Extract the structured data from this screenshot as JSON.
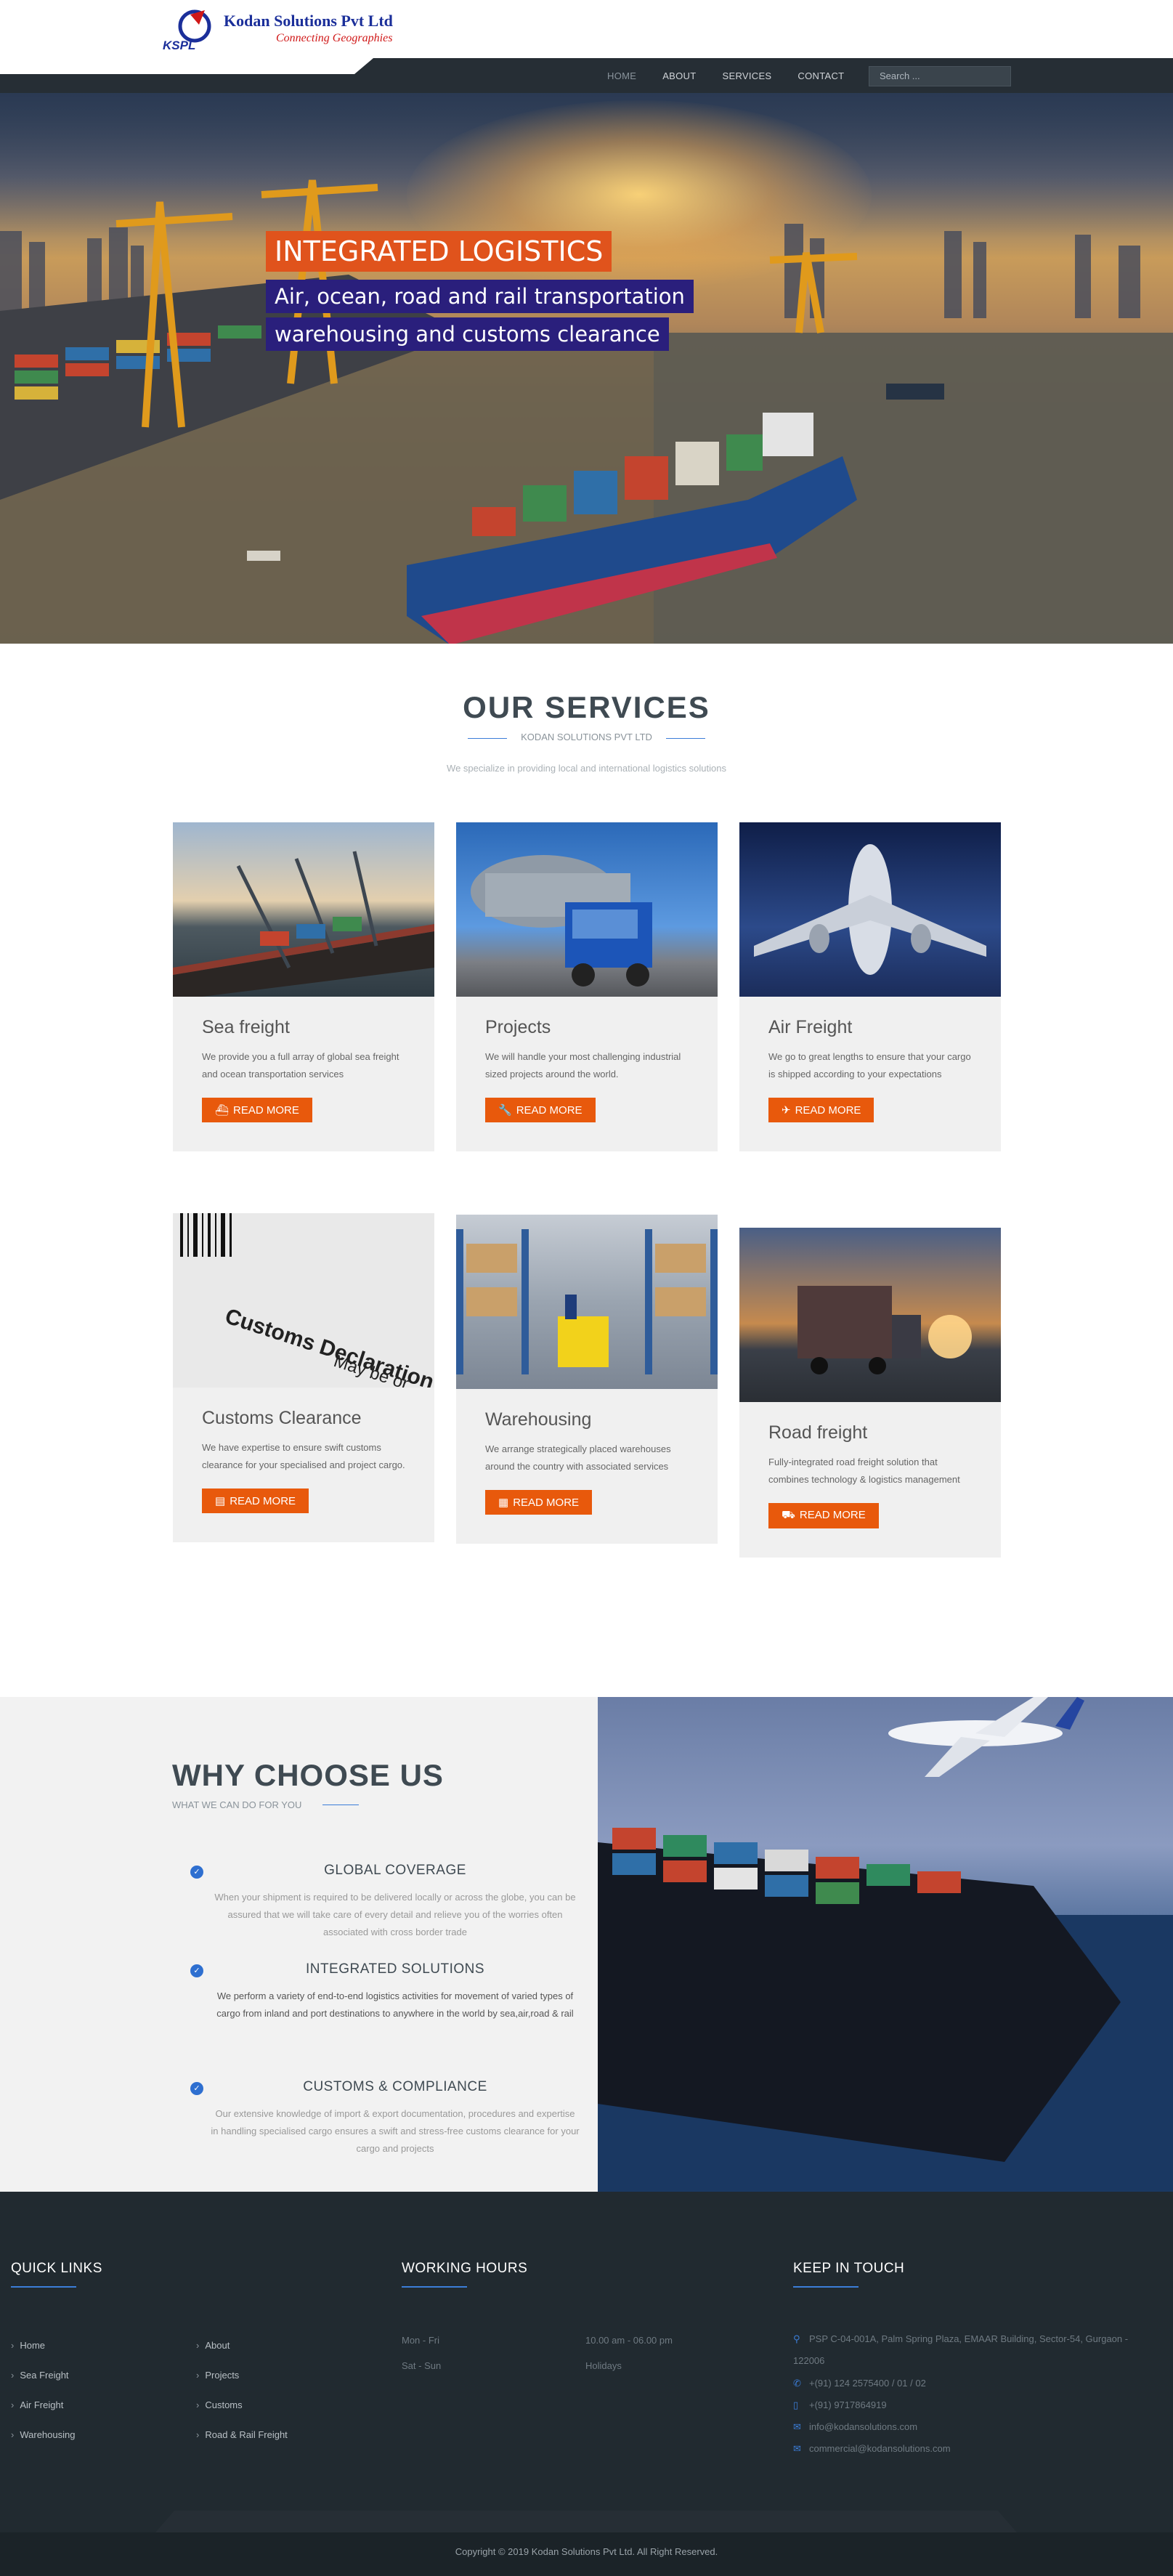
{
  "header": {
    "company_name": "Kodan Solutions Pvt Ltd",
    "tagline": "Connecting Geographies",
    "logo_abbr": "KSPL",
    "nav": [
      {
        "label": "HOME"
      },
      {
        "label": "ABOUT"
      },
      {
        "label": "SERVICES"
      },
      {
        "label": "CONTACT"
      }
    ],
    "search_placeholder": "Search ..."
  },
  "hero": {
    "title": "INTEGRATED LOGISTICS",
    "line1": "Air, ocean, road and rail transportation",
    "line2": "warehousing and customs clearance"
  },
  "services": {
    "title": "OUR SERVICES",
    "subtitle": "KODAN SOLUTIONS PVT LTD",
    "description": "We specialize in providing local and international logistics solutions",
    "cards": [
      {
        "title": "Sea freight",
        "text": "We provide you a full array of global sea freight and ocean transportation services",
        "button": "READ MORE",
        "icon": "ship-icon"
      },
      {
        "title": "Projects",
        "text": "We will handle your most challenging industrial sized projects around the world.",
        "button": "READ MORE",
        "icon": "wrench-icon"
      },
      {
        "title": "Air Freight",
        "text": "We go to great lengths to ensure that your cargo is shipped according to your expectations",
        "button": "READ MORE",
        "icon": "plane-icon"
      },
      {
        "title": "Customs Clearance",
        "text": "We have expertise to ensure swift customs clearance for your specialised and project cargo.",
        "button": "READ MORE",
        "icon": "document-icon"
      },
      {
        "title": "Warehousing",
        "text": "We arrange strategically placed warehouses around the country with associated services",
        "button": "READ MORE",
        "icon": "boxes-icon"
      },
      {
        "title": "Road freight",
        "text": "Fully-integrated road freight solution that combines technology & logistics management",
        "button": "READ MORE",
        "icon": "truck-icon"
      }
    ]
  },
  "why": {
    "title": "WHY CHOOSE US",
    "subtitle": "WHAT WE CAN DO FOR YOU",
    "items": [
      {
        "title": "GLOBAL COVERAGE",
        "text": "When your shipment is required to be delivered locally or across the globe, you can be assured that we will take care of every detail and relieve you of the worries often associated with cross border trade"
      },
      {
        "title": "INTEGRATED SOLUTIONS",
        "text": "We perform a variety of end-to-end logistics activities for movement of varied types of cargo from inland and port destinations to anywhere in the world by sea,air,road & rail"
      },
      {
        "title": "CUSTOMS & COMPLIANCE",
        "text": "Our extensive knowledge of import & export documentation, procedures and expertise in handling specialised cargo ensures a swift and stress-free customs clearance for your cargo and projects"
      }
    ]
  },
  "footer": {
    "quick_links_title": "QUICK LINKS",
    "links_col1": [
      "Home",
      "Sea Freight",
      "Air Freight",
      "Warehousing"
    ],
    "links_col2": [
      "About",
      "Projects",
      "Customs",
      "Road & Rail Freight"
    ],
    "hours_title": "WORKING HOURS",
    "hours": [
      {
        "days": "Mon - Fri",
        "time": "10.00 am - 06.00 pm"
      },
      {
        "days": "Sat - Sun",
        "time": "Holidays"
      }
    ],
    "contact_title": "KEEP IN TOUCH",
    "address": "PSP C-04-001A, Palm Spring Plaza, EMAAR Building, Sector-54, Gurgaon - 122006",
    "phone1": "+(91) 124 2575400 / 01 / 02",
    "phone2": "+(91) 9717864919",
    "email1": "info@kodansolutions.com",
    "email2": "commercial@kodansolutions.com",
    "copyright": "Copyright ©  2019 Kodan Solutions Pvt Ltd. All Right Reserved."
  },
  "colors": {
    "accent_orange": "#e8590c",
    "accent_blue": "#3b7dd8",
    "nav_dark": "#262e35",
    "footer_dark": "#212a30",
    "hero_title_bg": "#e0531c",
    "hero_line_bg": "#2a1f7c"
  }
}
